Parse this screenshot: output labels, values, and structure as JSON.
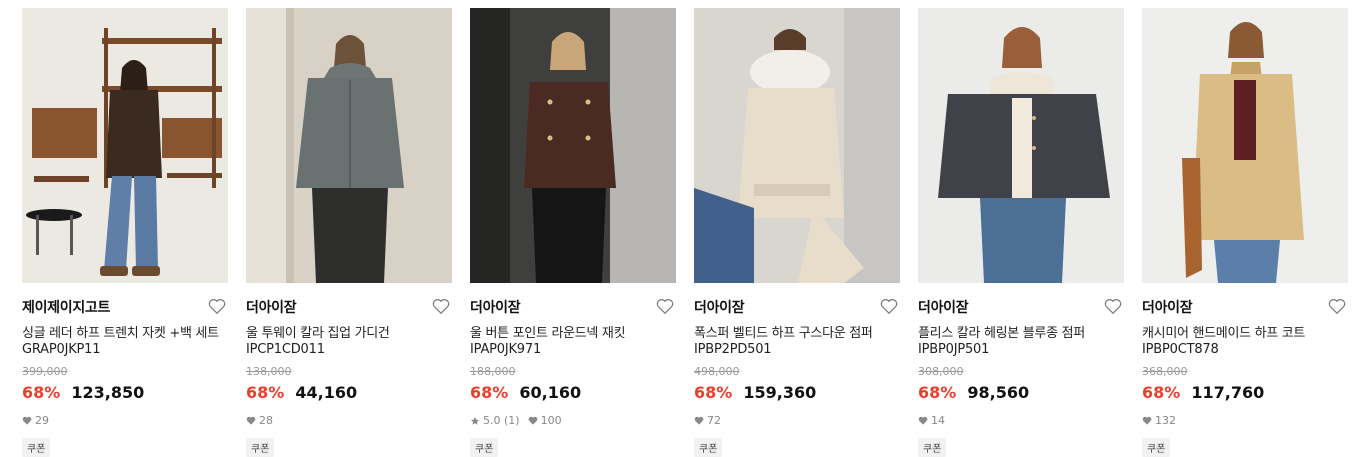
{
  "colors": {
    "discount": "#ee3d2a",
    "price": "#111111",
    "original_price": "#9a9a9a",
    "meta": "#888888",
    "coupon_bg": "#f1f1f1"
  },
  "products": [
    {
      "brand": "제이제이지고트",
      "name": "싱글 레더 하프 트렌치 자켓 +백 세트",
      "code": "GRAP0JKP11",
      "original_price": "399,000",
      "discount": "68%",
      "price": "123,850",
      "likes": "29",
      "rating": "",
      "coupon": "쿠폰",
      "image": "model-in-leather-jacket-and-jeans"
    },
    {
      "brand": "더아이잗",
      "name": "울 투웨이 칼라 집업 가디건",
      "code": "IPCP1CD011",
      "original_price": "138,000",
      "discount": "68%",
      "price": "44,160",
      "likes": "28",
      "rating": "",
      "coupon": "쿠폰",
      "image": "model-in-grey-knit-cardigan"
    },
    {
      "brand": "더아이잗",
      "name": "울 버튼 포인트 라운드넥 재킷",
      "code": "IPAP0JK971",
      "original_price": "188,000",
      "discount": "68%",
      "price": "60,160",
      "likes": "100",
      "rating": "5.0 (1)",
      "coupon": "쿠폰",
      "image": "model-in-brown-tweed-jacket"
    },
    {
      "brand": "더아이잗",
      "name": "폭스퍼 벨티드 하프 구스다운 점퍼",
      "code": "IPBP2PD501",
      "original_price": "498,000",
      "discount": "68%",
      "price": "159,360",
      "likes": "72",
      "rating": "",
      "coupon": "쿠폰",
      "image": "model-in-cream-down-jacket"
    },
    {
      "brand": "더아이잗",
      "name": "플리스 칼라 헤링본 블루종 점퍼",
      "code": "IPBP0JP501",
      "original_price": "308,000",
      "discount": "68%",
      "price": "98,560",
      "likes": "14",
      "rating": "",
      "coupon": "쿠폰",
      "image": "model-in-herringbone-blouson"
    },
    {
      "brand": "더아이잗",
      "name": "캐시미어 핸드메이드 하프 코트",
      "code": "IPBP0CT878",
      "original_price": "368,000",
      "discount": "68%",
      "price": "117,760",
      "likes": "132",
      "rating": "",
      "coupon": "쿠폰",
      "image": "model-in-camel-coat"
    }
  ]
}
